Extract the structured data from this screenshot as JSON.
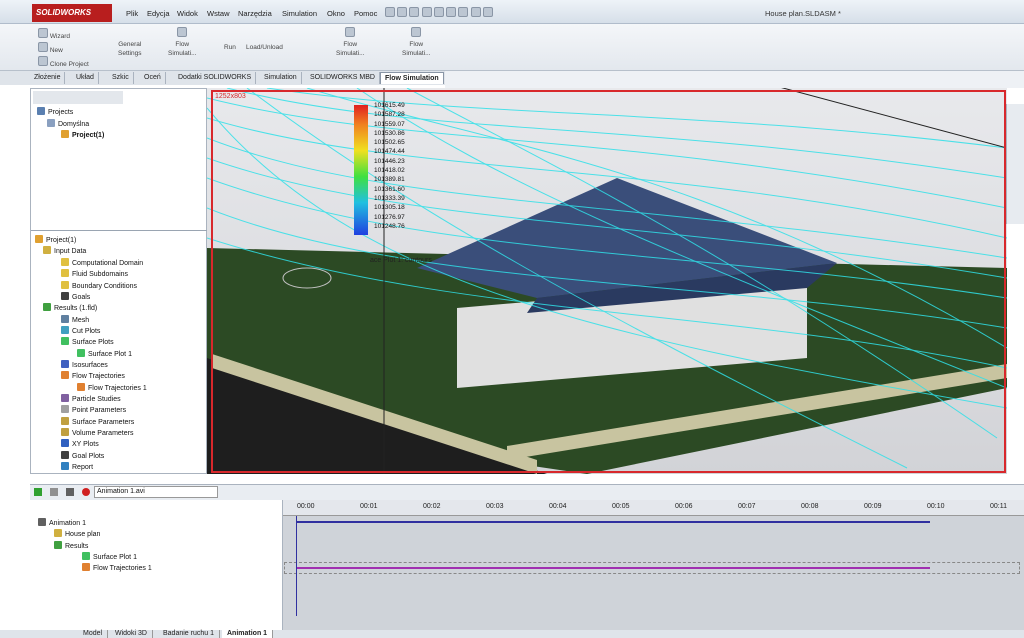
{
  "app": {
    "logo": "SOLIDWORKS",
    "doc_title": "House plan.SLDASM *"
  },
  "menu": [
    "Plik",
    "Edycja",
    "Widok",
    "Wstaw",
    "Narzędzia",
    "Simulation",
    "Okno",
    "Pomoc"
  ],
  "ribbon": {
    "wizard": "Wizard",
    "new": "New",
    "clone": "Clone Project",
    "general": "General",
    "settings": "Settings",
    "flow1": "Flow",
    "flow1b": "Simulati...",
    "run": "Run",
    "loadunload": "Load/Unload",
    "flow2": "Flow",
    "flow2b": "Simulati...",
    "flow3": "Flow",
    "flow3b": "Simulati..."
  },
  "tabs": [
    "Złożenie",
    "Układ",
    "Szkic",
    "Oceń",
    "Dodatki SOLIDWORKS",
    "Simulation",
    "SOLIDWORKS MBD",
    "Flow Simulation"
  ],
  "projects_tree": {
    "projects": "Projects",
    "domyslna": "Domyślna",
    "project": "Project(1)"
  },
  "results_tree": [
    "Project(1)",
    "Input Data",
    "Computational Domain",
    "Fluid Subdomains",
    "Boundary Conditions",
    "Goals",
    "Results (1.fld)",
    "Mesh",
    "Cut Plots",
    "Surface Plots",
    "Surface Plot 1",
    "Isosurfaces",
    "Flow Trajectories",
    "Flow Trajectories 1",
    "Particle Studies",
    "Point Parameters",
    "Surface Parameters",
    "Volume Parameters",
    "XY Plots",
    "Goal Plots",
    "Report"
  ],
  "viewport": {
    "size_label": "1252x803",
    "contour_label": "ace Plot 1: contours",
    "legend_values": [
      "101615.49",
      "101587.28",
      "101559.07",
      "101530.86",
      "101502.65",
      "101474.44",
      "101446.23",
      "101418.02",
      "101389.81",
      "101361.60",
      "101333.39",
      "101305.18",
      "101276.97",
      "101248.76"
    ]
  },
  "animation": {
    "filename": "Animation 1.avi",
    "tree": [
      "Animation 1",
      "House plan",
      "Results",
      "Surface Plot 1",
      "Flow Trajectories 1"
    ],
    "ticks": [
      "00:00",
      "00:01",
      "00:02",
      "00:03",
      "00:04",
      "00:05",
      "00:06",
      "00:07",
      "00:08",
      "00:09",
      "00:10",
      "00:11"
    ]
  },
  "status_tabs": [
    "Model",
    "Widoki 3D",
    "Badanie ruchu 1",
    "Animation 1"
  ],
  "colors": {
    "accent": "#d8282c",
    "tree_track": "#3030a0",
    "traj_track": "#a030b0",
    "streamline": "#30e0e8"
  }
}
